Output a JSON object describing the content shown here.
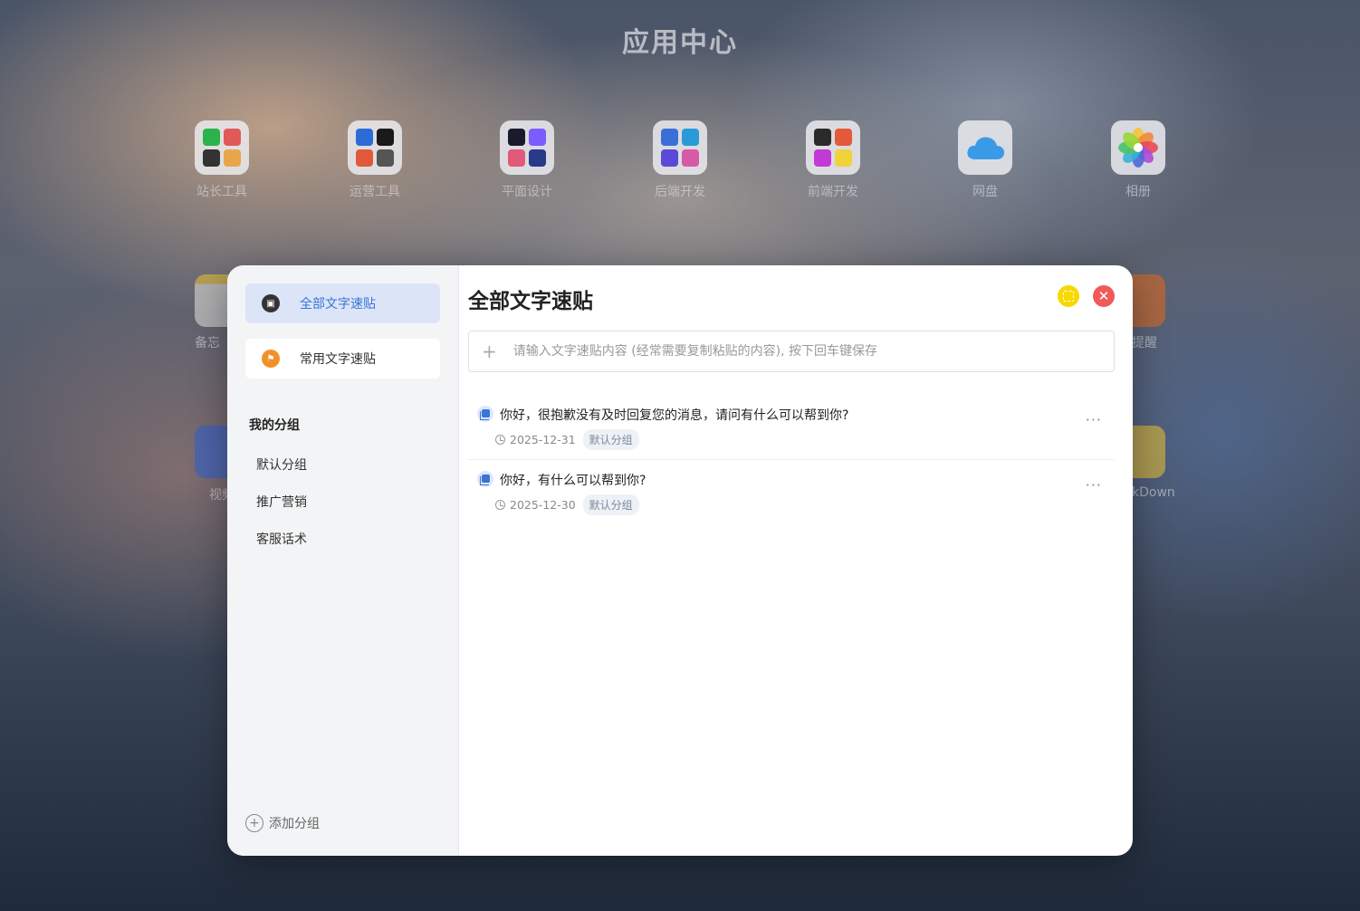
{
  "desktop": {
    "title": "应用中心",
    "apps": [
      {
        "label": "站长工具"
      },
      {
        "label": "运营工具"
      },
      {
        "label": "平面设计"
      },
      {
        "label": "后端开发"
      },
      {
        "label": "前端开发"
      },
      {
        "label": "网盘"
      },
      {
        "label": "相册"
      }
    ],
    "partial_labels": [
      "备忘",
      "提醒",
      "视频",
      "kDown"
    ]
  },
  "sidebar": {
    "items": [
      {
        "label": "全部文字速贴",
        "active": true
      },
      {
        "label": "常用文字速贴",
        "active": false
      }
    ],
    "group_title": "我的分组",
    "groups": [
      "默认分组",
      "推广营销",
      "客服话术"
    ],
    "add_group_label": "添加分组"
  },
  "main": {
    "title": "全部文字速贴",
    "input_placeholder": "请输入文字速贴内容 (经常需要复制粘贴的内容), 按下回车键保存",
    "notes": [
      {
        "text": "你好，很抱歉没有及时回复您的消息，请问有什么可以帮到你?",
        "date": "2025-12-31",
        "group": "默认分组"
      },
      {
        "text": "你好，有什么可以帮到你?",
        "date": "2025-12-30",
        "group": "默认分组"
      }
    ],
    "more_label": "···"
  },
  "colors": {
    "accent": "#3b74d6",
    "active_bg": "#dbe5f7",
    "fullscreen_btn": "#f7d900",
    "close_btn": "#f05a5a"
  }
}
